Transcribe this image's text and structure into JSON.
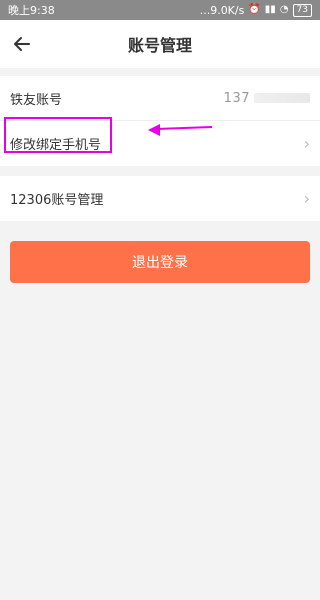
{
  "statusbar": {
    "time": "晚上9:38",
    "speed": "...9.0K/s",
    "battery": "73"
  },
  "header": {
    "title": "账号管理"
  },
  "rows": [
    {
      "label": "铁友账号",
      "value": "137"
    },
    {
      "label": "修改绑定手机号"
    }
  ],
  "row12306": {
    "label": "12306账号管理"
  },
  "logout": {
    "label": "退出登录"
  },
  "colors": {
    "accent": "#ff7149",
    "highlight": "#e600e6"
  },
  "icons": [
    "back-arrow-icon",
    "chevron-right-icon",
    "wifi-icon",
    "signal-icon",
    "alarm-icon"
  ]
}
